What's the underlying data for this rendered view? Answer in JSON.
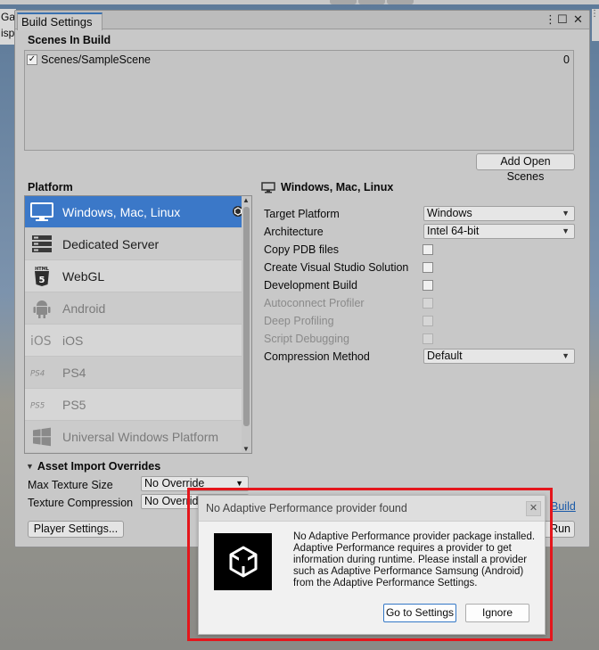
{
  "background": {
    "left_stub_lines": [
      "Gam",
      "isp"
    ],
    "right_stub_glyph": "⋮"
  },
  "window": {
    "tab_title": "Build Settings",
    "controls": {
      "menu": "⋮",
      "maximize": "☐",
      "close": "✕"
    }
  },
  "scenes": {
    "header": "Scenes In Build",
    "items": [
      {
        "name": "Scenes/SampleScene",
        "checked": true,
        "index": "0"
      }
    ],
    "add_open_scenes_label": "Add Open Scenes"
  },
  "platform": {
    "header": "Platform",
    "items": [
      {
        "label": "Windows, Mac, Linux",
        "icon": "monitor-icon",
        "selected": true
      },
      {
        "label": "Dedicated Server",
        "icon": "server-icon"
      },
      {
        "label": "WebGL",
        "icon": "html5-icon"
      },
      {
        "label": "Android",
        "icon": "android-icon",
        "dim": true
      },
      {
        "label": "iOS",
        "icon": "ios-icon",
        "dim": true
      },
      {
        "label": "PS4",
        "icon": "ps4-icon",
        "dim": true
      },
      {
        "label": "PS5",
        "icon": "ps5-icon",
        "dim": true
      },
      {
        "label": "Universal Windows Platform",
        "icon": "windows-logo-icon",
        "dim": true
      }
    ]
  },
  "settings": {
    "title": "Windows, Mac, Linux",
    "target_platform_label": "Target Platform",
    "target_platform_value": "Windows",
    "architecture_label": "Architecture",
    "architecture_value": "Intel 64-bit",
    "copy_pdb_label": "Copy PDB files",
    "create_vs_label": "Create Visual Studio Solution",
    "development_build_label": "Development Build",
    "autoconnect_label": "Autoconnect Profiler",
    "deep_profiling_label": "Deep Profiling",
    "script_debugging_label": "Script Debugging",
    "compression_label": "Compression Method",
    "compression_value": "Default"
  },
  "asset_import": {
    "header": "Asset Import Overrides",
    "max_texture_label": "Max Texture Size",
    "max_texture_value": "No Override",
    "texture_compression_label": "Texture Compression",
    "texture_compression_value": "No Override"
  },
  "bottom": {
    "player_settings_label": "Player Settings...",
    "build_link_partial": "Build",
    "run_partial": "Run"
  },
  "dialog": {
    "title": "No Adaptive Performance provider found",
    "close_glyph": "✕",
    "message": "No Adaptive Performance provider package installed. Adaptive Performance requires a provider to get information during runtime. Please install a provider such as Adaptive Performance Samsung (Android) from the Adaptive Performance Settings.",
    "go_to_settings_label": "Go to Settings",
    "ignore_label": "Ignore"
  },
  "colors": {
    "selected_platform": "#3b78c8",
    "highlight_border": "#e4161c",
    "link": "#1a5aa8"
  }
}
